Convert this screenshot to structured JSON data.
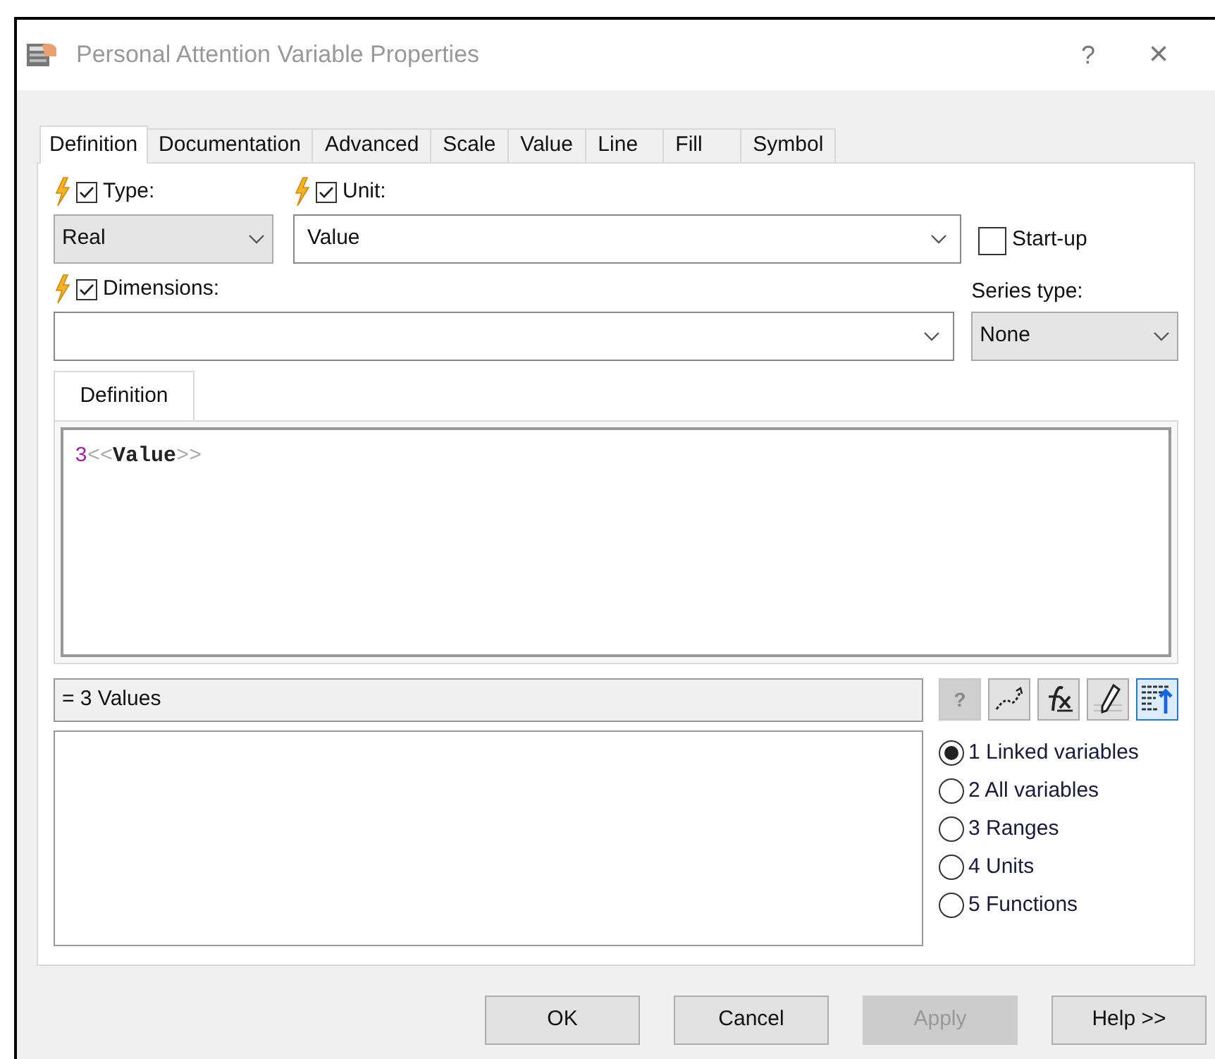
{
  "window": {
    "title": "Personal Attention Variable Properties",
    "help_button": "?",
    "close_button": "×"
  },
  "tabs": [
    {
      "label": "Definition",
      "selected": true
    },
    {
      "label": "Documentation",
      "selected": false
    },
    {
      "label": "Advanced",
      "selected": false
    },
    {
      "label": "Scale",
      "selected": false
    },
    {
      "label": "Value",
      "selected": false
    },
    {
      "label": "Line",
      "selected": false
    },
    {
      "label": "Fill",
      "selected": false
    },
    {
      "label": "Symbol",
      "selected": false
    }
  ],
  "type": {
    "label": "Type:",
    "checked": true,
    "value": "Real"
  },
  "unit": {
    "label": "Unit:",
    "checked": true,
    "value": "Value"
  },
  "startup": {
    "label": "Start-up",
    "checked": false
  },
  "dimensions": {
    "label": "Dimensions:",
    "checked": true
  },
  "series_type": {
    "label": "Series type:",
    "value": "None"
  },
  "inner_tab": {
    "label": "Definition",
    "selected": true
  },
  "definition": [
    {
      "text": "3",
      "kind": "number"
    },
    {
      "text": "<<",
      "kind": "bracket"
    },
    {
      "text": "Value",
      "kind": "name"
    },
    {
      "text": ">>",
      "kind": "bracket"
    }
  ],
  "result": "= 3 Values",
  "tools": [
    {
      "kind": "help",
      "label": "?",
      "disabled": true,
      "selected": false
    },
    {
      "kind": "curve",
      "disabled": false,
      "selected": false
    },
    {
      "kind": "fx",
      "disabled": false,
      "selected": false
    },
    {
      "kind": "pencil",
      "disabled": false,
      "selected": false
    },
    {
      "kind": "format",
      "disabled": false,
      "selected": true
    }
  ],
  "list_options": [
    {
      "label": "1 Linked variables",
      "selected": true
    },
    {
      "label": "2 All variables",
      "selected": false
    },
    {
      "label": "3 Ranges",
      "selected": false
    },
    {
      "label": "4 Units",
      "selected": false
    },
    {
      "label": "5 Functions",
      "selected": false
    }
  ],
  "buttons": [
    {
      "label": "OK",
      "disabled": false
    },
    {
      "label": "Cancel",
      "disabled": false
    },
    {
      "label": "Apply",
      "disabled": true
    },
    {
      "label": "Help >>",
      "disabled": false
    }
  ]
}
